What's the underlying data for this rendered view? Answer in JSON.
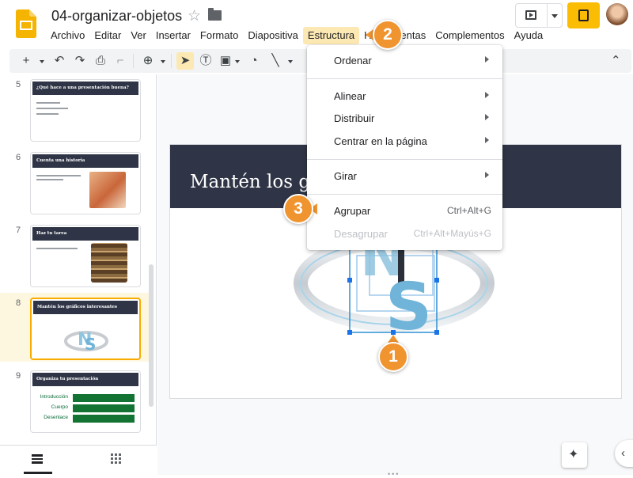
{
  "app": {
    "doc_title": "04-organizar-objetos",
    "menus": [
      "Archivo",
      "Editar",
      "Ver",
      "Insertar",
      "Formato",
      "Diapositiva",
      "Estructura",
      "Herramientas",
      "Complementos",
      "Ayuda"
    ],
    "active_menu": "Estructura"
  },
  "dropdown": {
    "items": [
      {
        "label": "Ordenar",
        "submenu": true
      },
      {
        "label": "Alinear",
        "submenu": true
      },
      {
        "label": "Distribuir",
        "submenu": true
      },
      {
        "label": "Centrar en la página",
        "submenu": true
      },
      {
        "label": "Girar",
        "submenu": true
      },
      {
        "label": "Agrupar",
        "shortcut": "Ctrl+Alt+G",
        "enabled": true
      },
      {
        "label": "Desagrupar",
        "shortcut": "Ctrl+Alt+Mayús+G",
        "enabled": false
      }
    ]
  },
  "filmstrip": {
    "slides": [
      {
        "number": "5",
        "title": "¿Qué hace a una presentación buena?"
      },
      {
        "number": "6",
        "title": "Cuenta una historia"
      },
      {
        "number": "7",
        "title": "Haz tu tarea"
      },
      {
        "number": "8",
        "title": "Mantén los gráficos interesantes",
        "selected": true
      },
      {
        "number": "9",
        "title": "Organiza tu presentación",
        "labels": [
          "Introducción",
          "Cuerpo",
          "Desenlace"
        ]
      }
    ]
  },
  "slide": {
    "title": "Mantén los gráficos interesantes"
  },
  "callouts": [
    "1",
    "2",
    "3"
  ],
  "colors": {
    "accent_orange": "#f0942f",
    "active_menu_bg": "#fce8b2",
    "slide_header": "#2f3546",
    "selection_blue": "#1a73e8",
    "share_yellow": "#fbbc04"
  },
  "icons": [
    "slides-logo",
    "star-icon",
    "folder-icon",
    "present-icon",
    "share-lock-icon",
    "avatar",
    "add-icon",
    "undo-icon",
    "redo-icon",
    "print-icon",
    "paint-format-icon",
    "zoom-icon",
    "select-icon",
    "textbox-icon",
    "image-icon",
    "shape-icon",
    "line-icon",
    "collapse-icon",
    "explore-icon",
    "chevron-left-icon",
    "list-view-icon",
    "grid-view-icon"
  ]
}
